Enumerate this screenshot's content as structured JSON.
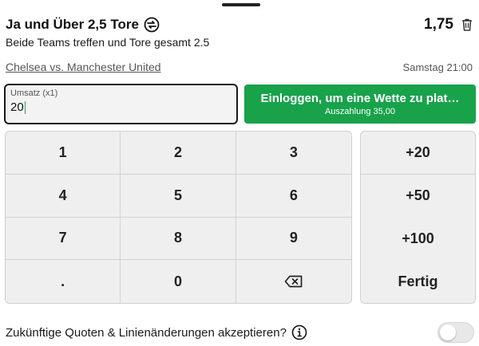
{
  "bet": {
    "title": "Ja und Über 2,5 Tore",
    "description": "Beide Teams treffen und Tore gesamt 2.5",
    "odds": "1,75",
    "match": "Chelsea vs. Manchester United",
    "kickoff": "Samstag 21:00"
  },
  "stake": {
    "label": "Umsatz (x1)",
    "value": "20"
  },
  "login_button": {
    "label": "Einloggen, um eine Wette zu plat…",
    "payout": "Auszahlung 35,00",
    "color": "#18a24a"
  },
  "keypad": {
    "keys": [
      "1",
      "2",
      "3",
      "4",
      "5",
      "6",
      "7",
      "8",
      "9",
      ".",
      "0",
      "backspace-icon"
    ]
  },
  "quick_stakes": {
    "keys": [
      "+20",
      "+50",
      "+100",
      "Fertig"
    ]
  },
  "accept_changes": {
    "label": "Zukünftige Quoten & Linienänderungen akzeptieren?",
    "enabled": false
  }
}
